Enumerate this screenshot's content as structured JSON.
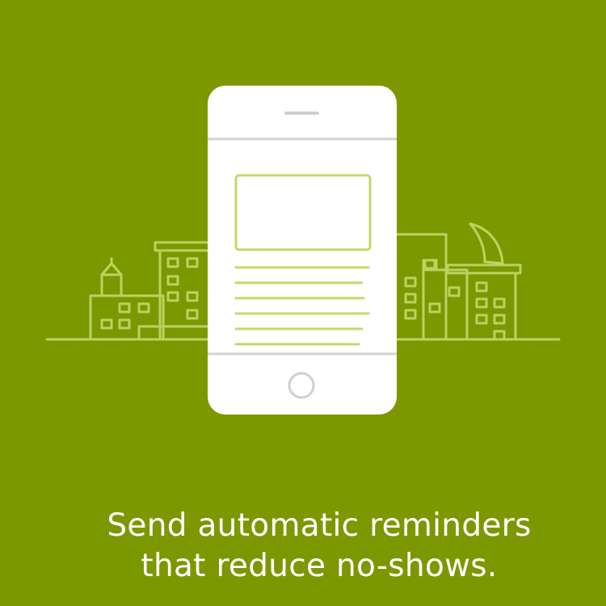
{
  "colors": {
    "background": "#7d9700",
    "phone_body": "#ffffff",
    "phone_detail": "#cfcfcf",
    "accent_line": "#c4d96a",
    "text": "#ffffff"
  },
  "illustration": {
    "icon": "phone-reminder-icon",
    "skyline_icon": "city-skyline-icon",
    "moon_icon": "crescent-moon-icon"
  },
  "caption": {
    "line1": "Send automatic reminders",
    "line2": "that reduce no-shows."
  }
}
